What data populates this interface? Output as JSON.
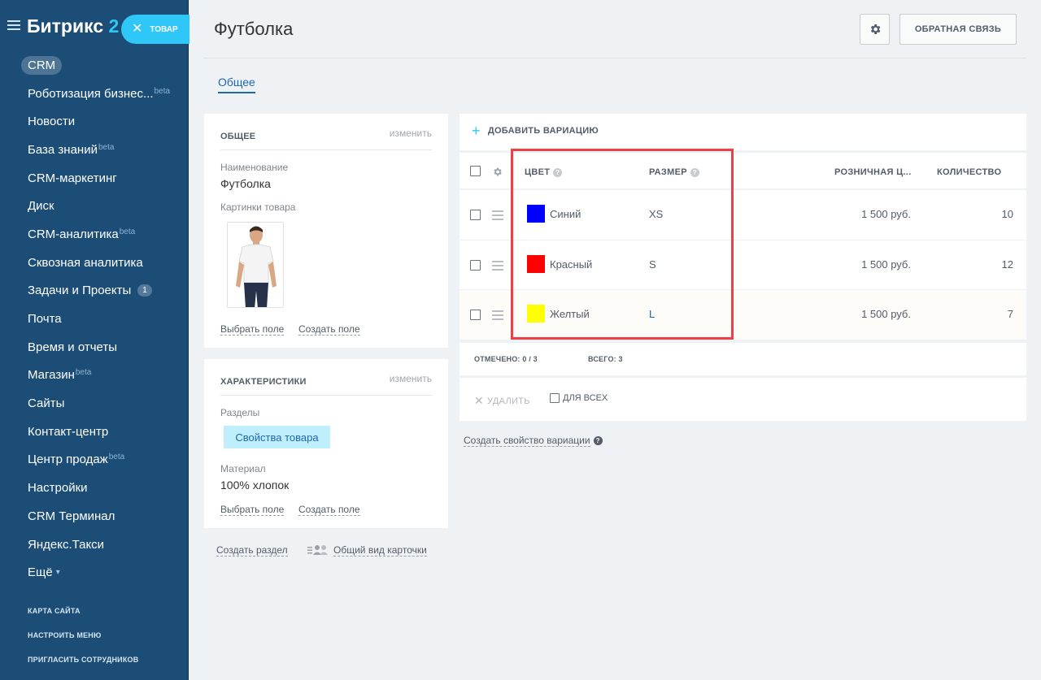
{
  "sidebar": {
    "logo_text": "Битрикс",
    "logo_num": "2",
    "badge_label": "ТОВАР",
    "items": [
      {
        "label": "CRM",
        "sup": ""
      },
      {
        "label": "Роботизация бизнес...",
        "sup": "beta"
      },
      {
        "label": "Новости",
        "sup": ""
      },
      {
        "label": "База знаний",
        "sup": "beta"
      },
      {
        "label": "CRM-маркетинг",
        "sup": ""
      },
      {
        "label": "Диск",
        "sup": ""
      },
      {
        "label": "CRM-аналитика",
        "sup": "beta"
      },
      {
        "label": "Сквозная аналитика",
        "sup": ""
      },
      {
        "label": "Задачи и Проекты",
        "sup": "",
        "counter": "1"
      },
      {
        "label": "Почта",
        "sup": ""
      },
      {
        "label": "Время и отчеты",
        "sup": ""
      },
      {
        "label": "Магазин",
        "sup": "beta"
      },
      {
        "label": "Сайты",
        "sup": ""
      },
      {
        "label": "Контакт-центр",
        "sup": ""
      },
      {
        "label": "Центр продаж",
        "sup": "beta"
      },
      {
        "label": "Настройки",
        "sup": ""
      },
      {
        "label": "CRM Терминал",
        "sup": ""
      },
      {
        "label": "Яндекс.Такси",
        "sup": ""
      },
      {
        "label": "Ещё",
        "sup": ""
      }
    ],
    "footer": [
      "КАРТА САЙТА",
      "НАСТРОИТЬ МЕНЮ",
      "ПРИГЛАСИТЬ СОТРУДНИКОВ"
    ]
  },
  "header": {
    "title": "Футболка",
    "feedback_label": "ОБРАТНАЯ СВЯЗЬ",
    "tab_label": "Общее"
  },
  "card_general": {
    "title": "ОБЩЕЕ",
    "edit": "изменить",
    "name_label": "Наименование",
    "name_value": "Футболка",
    "images_label": "Картинки товара",
    "select_field": "Выбрать поле",
    "create_field": "Создать поле"
  },
  "card_props": {
    "title": "ХАРАКТЕРИСТИКИ",
    "edit": "изменить",
    "sections_label": "Разделы",
    "section_chip": "Свойства товара",
    "material_label": "Материал",
    "material_value": "100% хлопок",
    "select_field": "Выбрать поле",
    "create_field": "Создать поле"
  },
  "bottom_links": {
    "create_section": "Создать раздел",
    "card_view": "Общий вид карточки"
  },
  "variations": {
    "add_label": "ДОБАВИТЬ ВАРИАЦИЮ",
    "columns": {
      "color": "ЦВЕТ",
      "size": "РАЗМЕР",
      "price": "РОЗНИЧНАЯ Ц...",
      "qty": "КОЛИЧЕСТВО"
    },
    "rows": [
      {
        "color_name": "Синий",
        "color_hex": "#0000ff",
        "size": "XS",
        "price": "1 500 руб.",
        "qty": "10"
      },
      {
        "color_name": "Красный",
        "color_hex": "#ff0000",
        "size": "S",
        "price": "1 500 руб.",
        "qty": "12"
      },
      {
        "color_name": "Желтый",
        "color_hex": "#ffff00",
        "size": "L",
        "price": "1 500 руб.",
        "qty": "7"
      }
    ],
    "selected_label": "ОТМЕЧЕНО: 0 / 3",
    "total_label": "ВСЕГО: 3",
    "delete_label": "УДАЛИТЬ",
    "for_all_label": "ДЛЯ ВСЕХ",
    "create_property": "Создать свойство вариации"
  },
  "colors": {
    "accent": "#2fc7f7",
    "sidebar": "#1b4d77",
    "link": "#2067b0",
    "highlight": "#ef3f45"
  }
}
